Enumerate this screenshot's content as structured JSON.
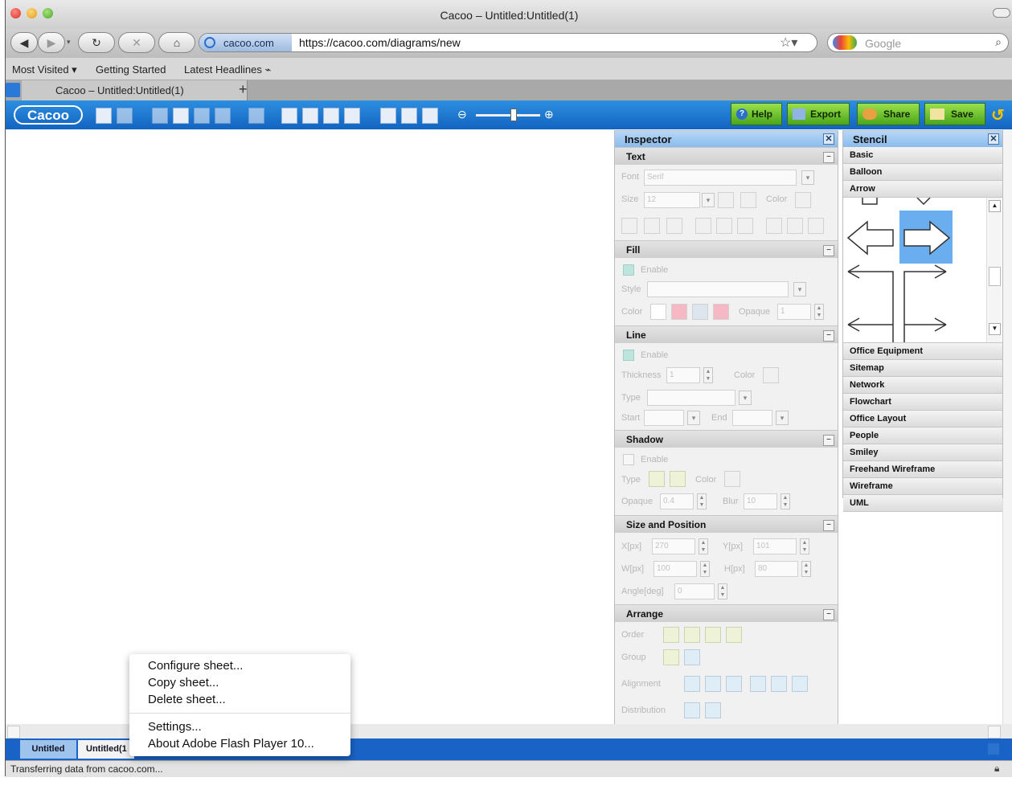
{
  "window": {
    "title": "Cacoo – Untitled:Untitled(1)"
  },
  "nav": {
    "site_identity": "cacoo.com",
    "url": "https://cacoo.com/diagrams/new",
    "search_placeholder": "Google"
  },
  "bookmarks": [
    "Most Visited ▾",
    "Getting Started",
    "Latest Headlines ⌁"
  ],
  "tab": {
    "title": "Cacoo – Untitled:Untitled(1)",
    "new_tab": "+"
  },
  "cacoo": {
    "logo": "Cacoo",
    "buttons": {
      "help": "Help",
      "export": "Export",
      "share": "Share",
      "save": "Save"
    }
  },
  "inspector": {
    "title": "Inspector",
    "sections": {
      "text": "Text",
      "fill": "Fill",
      "line": "Line",
      "shadow": "Shadow",
      "size_position": "Size and Position",
      "arrange": "Arrange"
    },
    "text": {
      "font_label": "Font",
      "font_value": "Serif",
      "size_label": "Size",
      "size_value": "12",
      "color_label": "Color"
    },
    "fill": {
      "enable": "Enable",
      "style_label": "Style",
      "color_label": "Color",
      "opaque_label": "Opaque",
      "opaque_value": "1"
    },
    "line": {
      "enable": "Enable",
      "thickness_label": "Thickness",
      "thickness_value": "1",
      "color_label": "Color",
      "type_label": "Type",
      "start_label": "Start",
      "end_label": "End"
    },
    "shadow": {
      "enable": "Enable",
      "type_label": "Type",
      "color_label": "Color",
      "opaque_label": "Opaque",
      "opaque_value": "0.4",
      "blur_label": "Blur",
      "blur_value": "10"
    },
    "size_position": {
      "x_label": "X[px]",
      "x_value": "270",
      "y_label": "Y[px]",
      "y_value": "101",
      "w_label": "W[px]",
      "w_value": "100",
      "h_label": "H[px]",
      "h_value": "80",
      "angle_label": "Angle[deg]",
      "angle_value": "0"
    },
    "arrange": {
      "order_label": "Order",
      "group_label": "Group",
      "alignment_label": "Alignment",
      "distribution_label": "Distribution"
    }
  },
  "stencil": {
    "title": "Stencil",
    "categories_top": [
      "Basic",
      "Balloon",
      "Arrow"
    ],
    "categories_bottom": [
      "Office Equipment",
      "Sitemap",
      "Network",
      "Flowchart",
      "Office Layout",
      "People",
      "Smiley",
      "Freehand Wireframe",
      "Wireframe",
      "UML"
    ]
  },
  "sheets": {
    "active": "Untitled",
    "second": "Untitled(1"
  },
  "context_menu": {
    "items": [
      "Configure sheet...",
      "Copy sheet...",
      "Delete sheet...",
      "Settings...",
      "About Adobe Flash Player 10..."
    ]
  },
  "status": {
    "text": "Transferring data from cacoo.com..."
  },
  "colors": {
    "cacoo_blue": "#1a6fd0",
    "panel_header": "#a8cdf3",
    "green_button": "#6ec52e",
    "selected_stencil": "#6aaef0"
  }
}
